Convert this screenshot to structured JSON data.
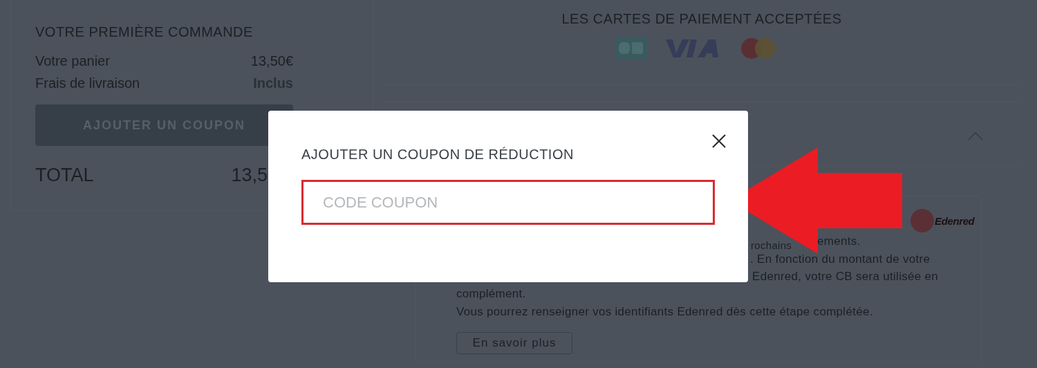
{
  "order_summary": {
    "title": "VOTRE PREMIÈRE COMMANDE",
    "rows": [
      {
        "label": "Votre panier",
        "value": "13,50€",
        "kind": "amount"
      },
      {
        "label": "Frais de livraison",
        "value": "Inclus",
        "kind": "included"
      }
    ],
    "coupon_button": "AJOUTER UN COUPON",
    "total_label": "TOTAL",
    "total_value": "13,5"
  },
  "payment": {
    "title": "LES CARTES DE PAIEMENT ACCEPTÉES"
  },
  "section": {
    "expanded": true
  },
  "edenred": {
    "logo_text": "Edenred",
    "lines": [
      {
        "kind": "split",
        "left": "rochains",
        "right": "ements."
      },
      {
        "kind": "cut",
        "text": ". En fonction du montant de votre"
      },
      {
        "kind": "cut",
        "text": "Edenred, votre CB sera utilisée en"
      },
      {
        "kind": "full",
        "text": "complément."
      },
      {
        "kind": "full",
        "text": "Vous pourrez renseigner vos identifiants Edenred dès cette étape complétée."
      }
    ],
    "link": "En savoir plus"
  },
  "modal": {
    "title": "AJOUTER UN COUPON DE RÉDUCTION",
    "input": {
      "placeholder": "CODE COUPON"
    }
  }
}
